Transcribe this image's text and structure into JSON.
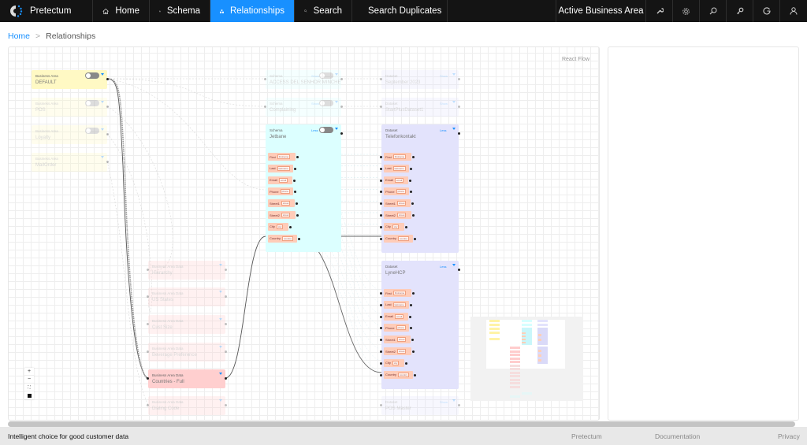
{
  "nav": {
    "brand": "Pretectum",
    "items": [
      {
        "label": "Home",
        "icon": "home-icon"
      },
      {
        "label": "Schema",
        "icon": "schema-icon"
      },
      {
        "label": "Relationships",
        "icon": "relationships-icon",
        "active": true
      },
      {
        "label": "Search",
        "icon": "search-icon"
      },
      {
        "label": "Search Duplicates",
        "icon": "search-duplicates-icon"
      }
    ],
    "business_area": "Active Business Area",
    "right_icons": [
      "wrench-icon",
      "gear-icon",
      "zoom-search-icon",
      "key-icon",
      "google-icon",
      "user-icon"
    ],
    "accent": "#1890ff"
  },
  "breadcrumb": {
    "home": "Home",
    "separator": ">",
    "current": "Relationships"
  },
  "flow": {
    "attribution": "React Flow",
    "business_areas": [
      {
        "type": "Business Area",
        "name": "DEFAULT",
        "active": true
      },
      {
        "type": "Business Area",
        "name": "POS",
        "active": false
      },
      {
        "type": "Business Area",
        "name": "Loyalty",
        "active": false
      },
      {
        "type": "Business Area",
        "name": "MailOrder",
        "active": false
      }
    ],
    "schemas": [
      {
        "type": "Schema",
        "name": "ACCESS DEL SENHOR MINCHE",
        "state": "Show",
        "active": false
      },
      {
        "type": "Schema",
        "name": "Complaining",
        "state": "Show",
        "active": false
      },
      {
        "type": "Schema",
        "name": "Jetbane",
        "state": "Less",
        "active": true
      }
    ],
    "datasets": [
      {
        "type": "Dataset",
        "name": "September 2023",
        "state": "Show",
        "active": false
      },
      {
        "type": "Dataset",
        "name": "StartPlusDataset1",
        "state": "Show",
        "active": false
      },
      {
        "type": "Dataset",
        "name": "Telefonkontakt",
        "state": "Less",
        "active": true
      },
      {
        "type": "Dataset",
        "name": "LyneHCP",
        "state": "Less",
        "active": true
      },
      {
        "type": "Dataset",
        "name": "POS Master",
        "state": "Show",
        "active": false
      }
    ],
    "business_area_data": [
      {
        "type": "Business Area Data",
        "name": "Hierarchy",
        "active": false
      },
      {
        "type": "Business Area Data",
        "name": "US States",
        "active": false
      },
      {
        "type": "Business Area Data",
        "name": "Cust Size",
        "active": false
      },
      {
        "type": "Business Area Data",
        "name": "Beverage Preference",
        "active": false
      },
      {
        "type": "Business Area Data",
        "name": "Countries - Full",
        "active": true
      },
      {
        "type": "Business Area Data",
        "name": "Dialing Code",
        "active": false
      }
    ],
    "fields": [
      {
        "name": "First",
        "tag": "firstname"
      },
      {
        "name": "Last",
        "tag": "lastname"
      },
      {
        "name": "Email",
        "tag": "email"
      },
      {
        "name": "Phone",
        "tag": "phone"
      },
      {
        "name": "Street1",
        "tag": "street"
      },
      {
        "name": "Street2",
        "tag": "street"
      },
      {
        "name": "City",
        "tag": "city"
      },
      {
        "name": "Country",
        "tag": "country"
      }
    ],
    "controls": [
      "+",
      "−",
      "⛶",
      "🔒"
    ]
  },
  "footer": {
    "tagline": "Intelligent choice for good customer data",
    "links": [
      "Pretectum",
      "Documentation",
      "Privacy"
    ]
  }
}
